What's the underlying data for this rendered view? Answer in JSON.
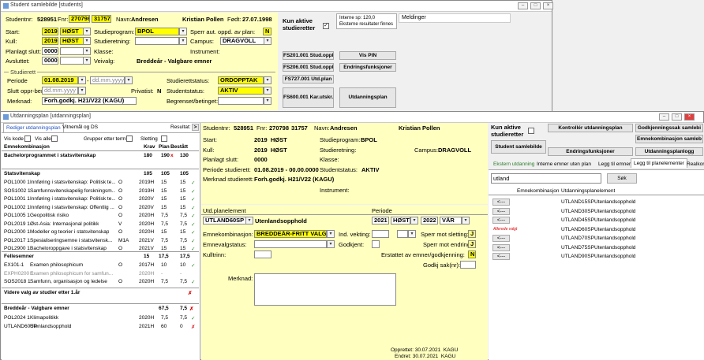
{
  "win1": {
    "title": "Student samlebilde [students]",
    "studentnr_label": "Studentnr:",
    "studentnr": "528951",
    "fnr_label": "Fnr:",
    "fnr1": "270798",
    "fnr2": "31757",
    "navn_label": "Navn:",
    "navn1": "Andresen",
    "navn2": "Kristian Pollen",
    "fodt_label": "Født:",
    "fodt": "27.07.1998",
    "start_label": "Start:",
    "start_year": "2019",
    "start_term": "HØST",
    "studieprogram_label": "Studieprogram:",
    "studieprogram": "BPOL",
    "sperr_label": "Sperr aut. oppd. av plan:",
    "sperr_val": "N",
    "kull_label": "Kull:",
    "kull_year": "2019",
    "kull_term": "HØST",
    "studieretning_label": "Studieretning:",
    "campus_label": "Campus:",
    "campus": "DRAGVOLL",
    "planlagt_label": "Planlagt slutt:",
    "planlagt": "0000",
    "klasse_label": "Klasse:",
    "instrument_label": "Instrument:",
    "avsluttet_label": "Avsluttet:",
    "avsluttet": "0000",
    "veivalg_label": "Veivalg:",
    "veivalg": "Breddeår - Valgbare emner",
    "studierett_label": "Studierett",
    "periode_label": "Periode",
    "periode_from": "01.08.2019",
    "periode_to": "dd.mm.yyyy",
    "studierettstatus_label": "Studierettstatus:",
    "studierettstatus": "ORDOPPTAK",
    "slutt_label": "Slutt oppr-ber:",
    "slutt": "dd.mm.yyyy",
    "privatist_label": "Privatist:",
    "privatist": "N",
    "studentstatus_label": "Studentstatus:",
    "studentstatus": "AKTIV",
    "merknad_label": "Merknad:",
    "merknad": "Forh.godkj. H21/V22 (KAGU)",
    "begrenset_label": "Begrenset/betinget:",
    "kun_aktive": "Kun aktive studieretter",
    "interne_sp": "Interne sp: 120,0",
    "eksterne": "Eksterne resultater finnes",
    "meldinger": "Meldinger",
    "btns": [
      "FS201.001 Stud.oppl.",
      "Vis PIN",
      "FS206.001 Stud.oppl.",
      "Endringsfunksjoner",
      "FS727.001 Utd.plan",
      "FS600.001 Kar.utskr.",
      "Utdanningsplan"
    ]
  },
  "win2": {
    "title": "Utdanningsplan [utdanningsplan]",
    "tabs": [
      "Rediger utdanningsplan",
      "Vitnemål og DS"
    ],
    "resultat": "Resultat:",
    "vis_kode": "Vis kode",
    "vis_alle": "Vis alle",
    "grupper": "Grupper etter termin",
    "sletting": "Sletting",
    "cols": {
      "emnekomb": "Emnekombinasjon",
      "krav": "Krav",
      "plan": "Plan",
      "bestatt": "Bestått"
    },
    "sections": [
      {
        "name": "Bachelorprogrammet i statsvitenskap",
        "krav": "180",
        "plan": "190",
        "bestatt": "130",
        "mark": "x"
      },
      {
        "name": "Statsvitenskap",
        "krav": "105",
        "plan": "105",
        "bestatt": "105"
      }
    ],
    "rows1": [
      [
        "POL1000 1",
        "Innføring i statsvitenskap: Politisk te...",
        "O",
        "2019H",
        "15",
        "15"
      ],
      [
        "SOS1002 1",
        "Samfunnsvitenskapelig forskningsm...",
        "O",
        "2019H",
        "15",
        "15"
      ],
      [
        "POL1001 1",
        "Innføring i statsvitenskap: Politisk te...",
        "O",
        "2020V",
        "15",
        "15"
      ],
      [
        "POL1002 1",
        "Innføring i statsvitenskap: Offentlig ...",
        "O",
        "2020V",
        "15",
        "15"
      ],
      [
        "POL1005 1",
        "Geopolitisk risiko",
        "O",
        "2020H",
        "7,5",
        "7,5"
      ],
      [
        "POL2019 1",
        "Øst-Asia: Internasjonal politikk",
        "V",
        "2020H",
        "7,5",
        "7,5"
      ],
      [
        "POL2000 1",
        "Modeller og teorier i statsvitenskap",
        "O",
        "2020H",
        "15",
        "15"
      ],
      [
        "POL2017 1",
        "Spesialiseringsemne i statsvitensk...",
        "M1A",
        "2021V",
        "7,5",
        "7,5"
      ],
      [
        "POL2900 1",
        "Bacheloroppgave i statsvitenskap",
        "O",
        "2021V",
        "15",
        "15"
      ]
    ],
    "fellesemner": {
      "name": "Fellesemner",
      "krav": "15",
      "plan": "17,5",
      "bestatt": "17,5"
    },
    "rows2": [
      [
        "EX101-1",
        "Examen philosophicum",
        "O",
        "2017H",
        "10",
        "10"
      ],
      [
        "EXPH0200 1",
        "Examen philosophicum for samfun...",
        "",
        "2020H",
        "-",
        "-"
      ],
      [
        "SOS2018 1",
        "Samfunn, organisasjon og ledelse",
        "O",
        "2020H",
        "7,5",
        "7,5"
      ]
    ],
    "videre": "Videre valg av studier etter 1.år",
    "bredde": {
      "name": "Breddeår - Valgbare emner",
      "krav": "67,5",
      "plan": "7,5"
    },
    "rows3": [
      [
        "POL2024 1",
        "Klimapolitikk",
        "",
        "2020H",
        "7,5",
        "7,5"
      ],
      [
        "UTLAND60SP",
        "Utenlandsopphold",
        "",
        "2021H",
        "60",
        "0"
      ]
    ],
    "mid": {
      "studentnr_label": "Studentnr:",
      "studentnr": "528951",
      "fnr_label": "Fnr:",
      "fnr1": "270798",
      "fnr2": "31757",
      "navn_label": "Navn:",
      "navn1": "Andresen",
      "navn2": "Kristian Pollen",
      "start_label": "Start:",
      "start": "2019  HØST",
      "studieprogram_label": "Studieprogram:",
      "studieprogram": "BPOL",
      "kull_label": "Kull:",
      "kull": "2019  HØST",
      "studieretning_label": "Studieretning:",
      "campus_label": "Campus:",
      "campus": "DRAGVOLL",
      "planlagt_label": "Planlagt slutt:",
      "planlagt": "0000",
      "klasse_label": "Klasse:",
      "periode_label": "Periode studierett:",
      "periode": "01.08.2019 - 00.00.0000",
      "studiestatus_label": "Studentstatus:",
      "studiestatus": "AKTIV",
      "merknad_label": "Merknad studierett:",
      "merknad": "Forh.godkj. H21/V22 (KAGU)",
      "instrument_label": "Instrument:",
      "utd_label": "Utd.planelement",
      "periode2_label": "Periode",
      "utd_code": "UTLAND60SP",
      "utd_name": "Utenlandsopphold",
      "p_year": "2021",
      "p_term": "HØST",
      "p_year2": "2022",
      "p_term2": "VÅR",
      "emnekomb_label": "Emnekombinasjon:",
      "emnekomb": "BREDDEÅR-FRITT VALG",
      "ind_label": "Ind. vekting:",
      "sperr_slett_label": "Sperr mot sletting:",
      "sperr_slett": "J",
      "emnevalg_label": "Emnevalgstatus:",
      "godkjent_label": "Godkjent:",
      "sperr_endr_label": "Sperr mot endring:",
      "sperr_endr": "J",
      "kulltrinn_label": "Kulltrinn:",
      "erstattet_label": "Erstattet av emner/godkjenning:",
      "erstattet": "N",
      "godkj_sak_label": "Godkj sak(nr):",
      "merknad2_label": "Merknad:",
      "opprettet": "Opprettet: 30.07.2021  KAGU",
      "endret": "Endret: 30.07.2021  KAGU"
    },
    "right": {
      "kun_aktive": "Kun aktive studieretter",
      "btns": [
        "Kontrollér utdanningsplan",
        "Godkjenningssak samlebi",
        "Emnekombinasjon samleb",
        "Student samlebilde",
        "Endringsfunksjoner",
        "Utdanningsplanlogg"
      ],
      "tabs": [
        "Ekstern utdanning",
        "Interne emner uten plan",
        "Legg til emner",
        "Legg til planelementer",
        "Realkor"
      ],
      "search": "utland",
      "sok": "Søk",
      "col1": "Emnekombinasjon",
      "col2": "Utdanningsplanelement",
      "arrow": "<---",
      "items": [
        [
          "UTLAND15SP",
          "Utenlandsopphold"
        ],
        [
          "UTLAND30SP",
          "Utenlandsopphold"
        ],
        [
          "UTLAND45SP",
          "Utenlandsopphold"
        ],
        [
          "UTLAND60SP",
          "Utenlandsopphold"
        ],
        [
          "UTLAND70SP",
          "Utenlandsopphold"
        ],
        [
          "UTLAND75SP",
          "Utenlandsopphold"
        ],
        [
          "UTLAND90SP",
          "Utenlandsopphold"
        ]
      ],
      "note": "Allerede valgt"
    }
  }
}
